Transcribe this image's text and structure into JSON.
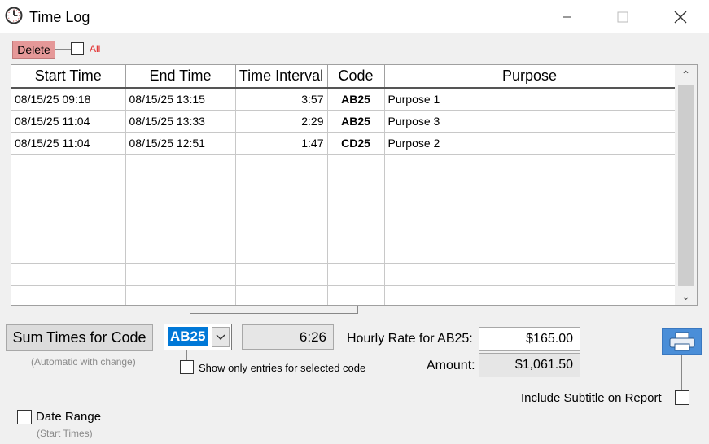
{
  "window": {
    "title": "Time Log",
    "minimize": "—",
    "maximize": "☐",
    "close": "✕"
  },
  "toolbar": {
    "delete_label": "Delete",
    "all_label": "All"
  },
  "grid": {
    "columns": [
      "Start Time",
      "End Time",
      "Time Interval",
      "Code",
      "Purpose"
    ],
    "rows": [
      {
        "start": "08/15/25 09:18",
        "end": "08/15/25 13:15",
        "interval": "3:57",
        "code": "AB25",
        "purpose": "Purpose 1"
      },
      {
        "start": "08/15/25 11:04",
        "end": "08/15/25 13:33",
        "interval": "2:29",
        "code": "AB25",
        "purpose": "Purpose 3"
      },
      {
        "start": "08/15/25 11:04",
        "end": "08/15/25 12:51",
        "interval": "1:47",
        "code": "CD25",
        "purpose": "Purpose 2"
      }
    ],
    "scroll_up": "⌃",
    "scroll_down": "⌄"
  },
  "summary": {
    "sum_button": "Sum Times for Code",
    "sum_hint": "(Automatic with change)",
    "selected_code": "AB25",
    "total_time": "6:26",
    "show_only_label": "Show only entries for selected code",
    "hourly_rate_label": "Hourly Rate for AB25:",
    "hourly_rate_value": "$165.00",
    "amount_label": "Amount:",
    "amount_value": "$1,061.50",
    "date_range_label": "Date Range",
    "date_range_hint": "(Start Times)",
    "include_subtitle_label": "Include Subtitle on Report"
  }
}
